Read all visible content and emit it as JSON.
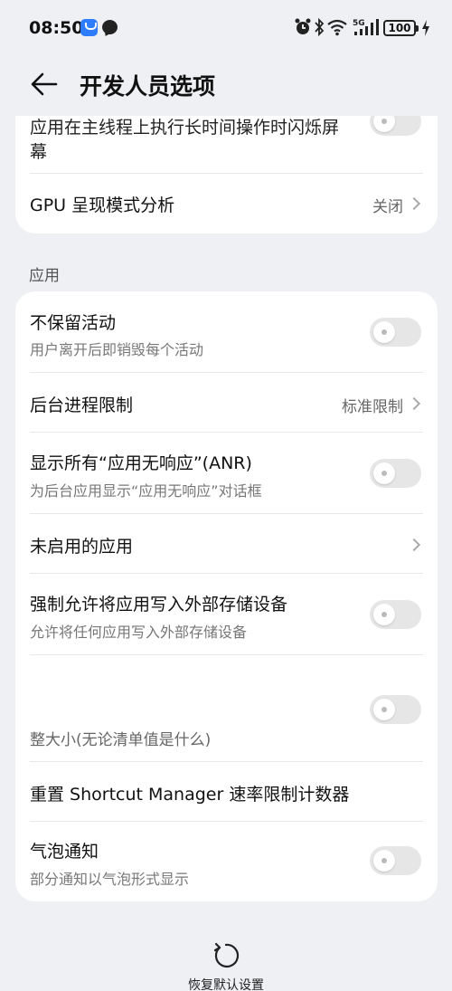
{
  "status_bar": {
    "time": "08:50",
    "battery": "100",
    "icons": [
      "app-store-icon",
      "message-icon",
      "alarm-icon",
      "bluetooth-icon",
      "wifi-icon",
      "signal-5g-icon",
      "battery-icon",
      "charging-icon"
    ]
  },
  "header": {
    "title": "开发人员选项"
  },
  "top_card": {
    "partial_row_title": "应用在主线程上执行长时间操作时闪烁屏",
    "partial_row_title_line2": "幕",
    "gpu_row": {
      "title": "GPU 呈现模式分析",
      "value": "关闭"
    }
  },
  "section": {
    "label": "应用"
  },
  "rows": [
    {
      "title": "不保留活动",
      "subtitle": "用户离开后即销毁每个活动"
    },
    {
      "title": "后台进程限制",
      "value": "标准限制"
    },
    {
      "title": "显示所有“应用无响应”(ANR)",
      "subtitle": "为后台应用显示“应用无响应”对话框"
    },
    {
      "title": "未启用的应用"
    },
    {
      "title": "强制允许将应用写入外部存储设备",
      "subtitle": "允许将任何应用写入外部存储设备"
    },
    {
      "title": "",
      "subtitle": "整大小(无论清单值是什么)"
    },
    {
      "title": "重置 Shortcut Manager 速率限制计数器"
    },
    {
      "title": "气泡通知",
      "subtitle": "部分通知以气泡形式显示"
    }
  ],
  "footer": {
    "reset_label": "恢复默认设置"
  }
}
